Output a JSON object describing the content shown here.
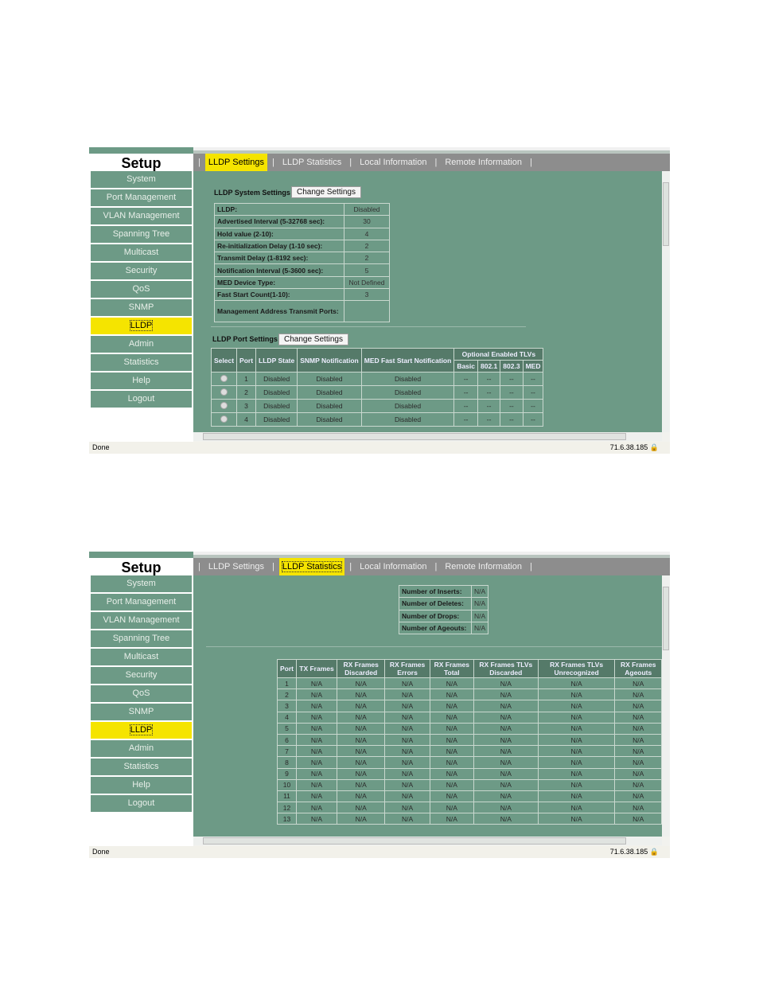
{
  "sidebar": {
    "title": "Setup",
    "items": [
      "System",
      "Port Management",
      "VLAN Management",
      "Spanning Tree",
      "Multicast",
      "Security",
      "QoS",
      "SNMP",
      "LLDP",
      "Admin",
      "Statistics",
      "Help",
      "Logout"
    ],
    "active": "LLDP"
  },
  "tabs": [
    "LLDP Settings",
    "LLDP Statistics",
    "Local Information",
    "Remote Information"
  ],
  "status": {
    "left": "Done",
    "ip": "71.6.38.185"
  },
  "colors": {
    "content": "#6d9a86",
    "active": "#f5e400",
    "tabbar": "#8d8d8d"
  },
  "screen1": {
    "active_tab": "LLDP Settings",
    "system": {
      "label": "LLDP System Settings",
      "button": "Change Settings",
      "rows": [
        [
          "LLDP:",
          "Disabled"
        ],
        [
          "Advertised Interval (5-32768 sec):",
          "30"
        ],
        [
          "Hold value (2-10):",
          "4"
        ],
        [
          "Re-initialization Delay (1-10 sec):",
          "2"
        ],
        [
          "Transmit Delay (1-8192 sec):",
          "2"
        ],
        [
          "Notification Interval (5-3600 sec):",
          "5"
        ],
        [
          "MED Device Type:",
          "Not Defined"
        ],
        [
          "Fast Start Count(1-10):",
          "3"
        ],
        [
          "Management Address Transmit Ports:",
          ""
        ]
      ]
    },
    "port": {
      "label": "LLDP Port Settings",
      "button": "Change Settings",
      "headers": [
        "Select",
        "Port",
        "LLDP State",
        "SNMP Notification",
        "MED Fast Start Notification"
      ],
      "group_header": "Optional Enabled TLVs",
      "sub_headers": [
        "Basic",
        "802.1",
        "802.3",
        "MED"
      ],
      "rows": [
        [
          "1",
          "Disabled",
          "Disabled",
          "Disabled",
          "--",
          "--",
          "--",
          "--"
        ],
        [
          "2",
          "Disabled",
          "Disabled",
          "Disabled",
          "--",
          "--",
          "--",
          "--"
        ],
        [
          "3",
          "Disabled",
          "Disabled",
          "Disabled",
          "--",
          "--",
          "--",
          "--"
        ],
        [
          "4",
          "Disabled",
          "Disabled",
          "Disabled",
          "--",
          "--",
          "--",
          "--"
        ]
      ]
    }
  },
  "screen2": {
    "active_tab": "LLDP Statistics",
    "summary": [
      [
        "Number of Inserts:",
        "N/A"
      ],
      [
        "Number of Deletes:",
        "N/A"
      ],
      [
        "Number of Drops:",
        "N/A"
      ],
      [
        "Number of Ageouts:",
        "N/A"
      ]
    ],
    "headers": [
      "Port",
      "TX Frames",
      "RX Frames Discarded",
      "RX Frames Errors",
      "RX Frames Total",
      "RX Frames TLVs Discarded",
      "RX Frames TLVs Unrecognized",
      "RX Frames Ageouts"
    ],
    "rows": [
      [
        "1",
        "N/A",
        "N/A",
        "N/A",
        "N/A",
        "N/A",
        "N/A",
        "N/A"
      ],
      [
        "2",
        "N/A",
        "N/A",
        "N/A",
        "N/A",
        "N/A",
        "N/A",
        "N/A"
      ],
      [
        "3",
        "N/A",
        "N/A",
        "N/A",
        "N/A",
        "N/A",
        "N/A",
        "N/A"
      ],
      [
        "4",
        "N/A",
        "N/A",
        "N/A",
        "N/A",
        "N/A",
        "N/A",
        "N/A"
      ],
      [
        "5",
        "N/A",
        "N/A",
        "N/A",
        "N/A",
        "N/A",
        "N/A",
        "N/A"
      ],
      [
        "6",
        "N/A",
        "N/A",
        "N/A",
        "N/A",
        "N/A",
        "N/A",
        "N/A"
      ],
      [
        "7",
        "N/A",
        "N/A",
        "N/A",
        "N/A",
        "N/A",
        "N/A",
        "N/A"
      ],
      [
        "8",
        "N/A",
        "N/A",
        "N/A",
        "N/A",
        "N/A",
        "N/A",
        "N/A"
      ],
      [
        "9",
        "N/A",
        "N/A",
        "N/A",
        "N/A",
        "N/A",
        "N/A",
        "N/A"
      ],
      [
        "10",
        "N/A",
        "N/A",
        "N/A",
        "N/A",
        "N/A",
        "N/A",
        "N/A"
      ],
      [
        "11",
        "N/A",
        "N/A",
        "N/A",
        "N/A",
        "N/A",
        "N/A",
        "N/A"
      ],
      [
        "12",
        "N/A",
        "N/A",
        "N/A",
        "N/A",
        "N/A",
        "N/A",
        "N/A"
      ],
      [
        "13",
        "N/A",
        "N/A",
        "N/A",
        "N/A",
        "N/A",
        "N/A",
        "N/A"
      ]
    ]
  }
}
